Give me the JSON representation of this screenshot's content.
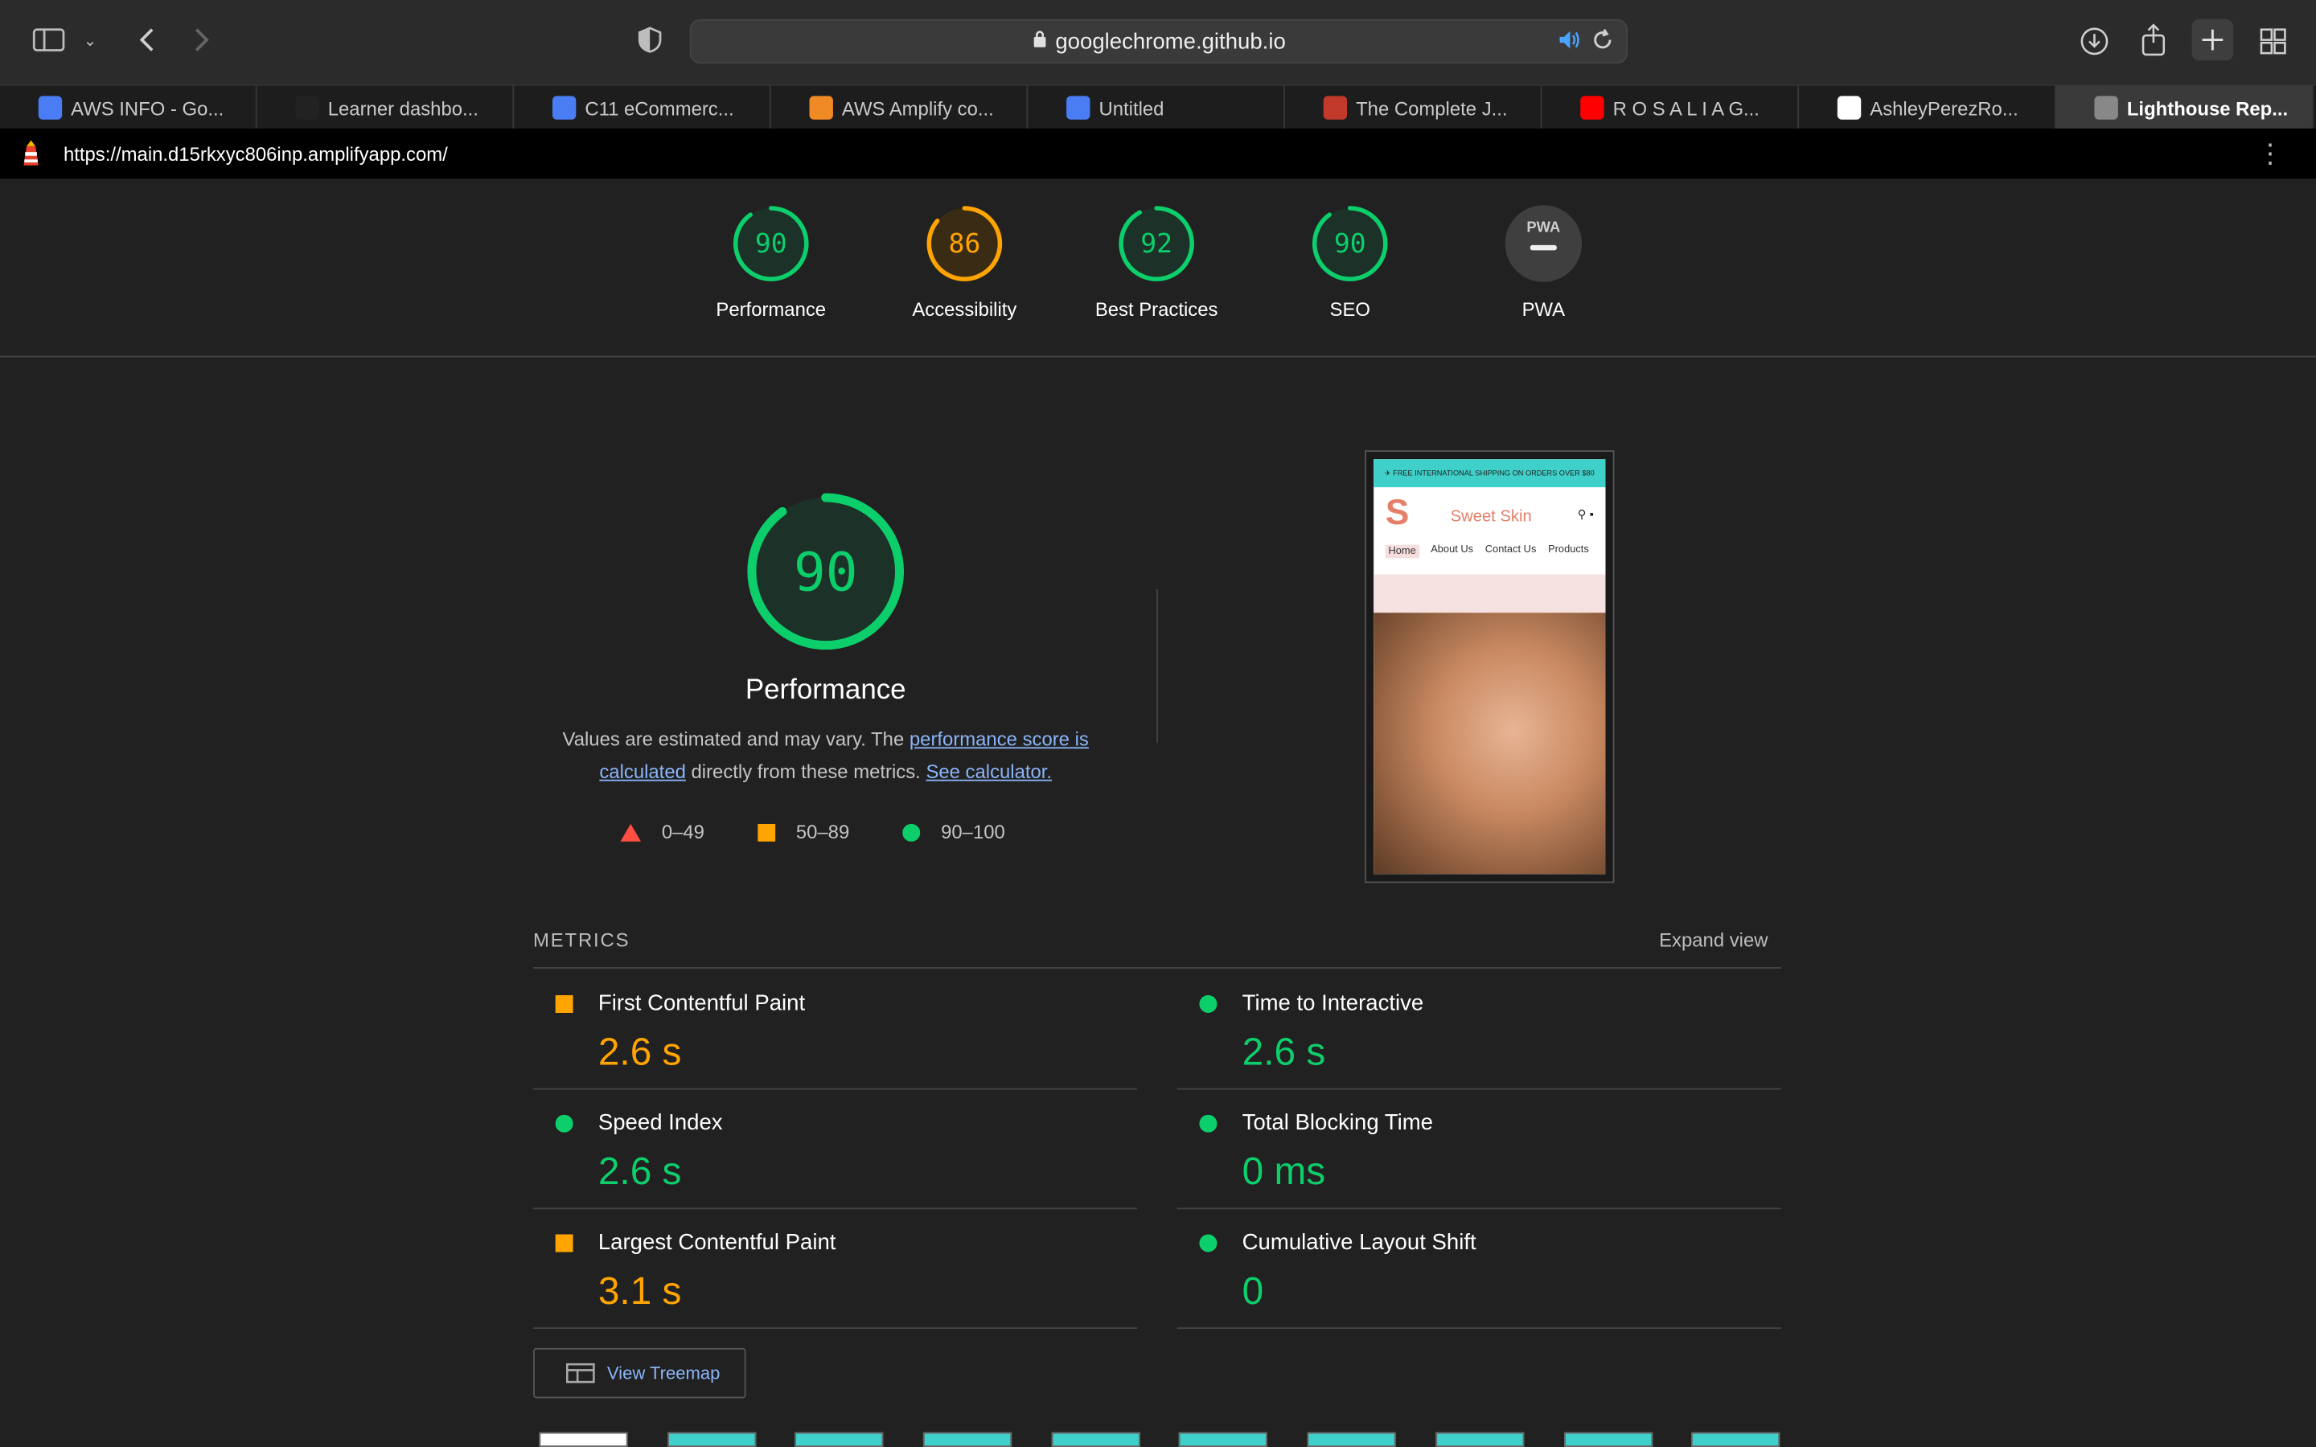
{
  "browser": {
    "address": "googlechrome.github.io"
  },
  "tabs": [
    {
      "label": "AWS INFO - Go...",
      "icon": "google-docs-icon",
      "color": "#4a7cf3"
    },
    {
      "label": "Learner dashbo...",
      "icon": "aws-icon",
      "color": "#222222"
    },
    {
      "label": "C11 eCommerc...",
      "icon": "google-docs-icon",
      "color": "#4a7cf3"
    },
    {
      "label": "AWS Amplify co...",
      "icon": "amplify-icon",
      "color": "#f08a24"
    },
    {
      "label": "Untitled",
      "icon": "google-docs-icon",
      "color": "#4a7cf3"
    },
    {
      "label": "The Complete J...",
      "icon": "course-icon",
      "color": "#c0392b"
    },
    {
      "label": "R O S A L I A G...",
      "icon": "youtube-icon",
      "color": "#ff0000"
    },
    {
      "label": "AshleyPerezRo...",
      "icon": "github-icon",
      "color": "#ffffff"
    },
    {
      "label": "Lighthouse Rep...",
      "icon": "g-icon",
      "color": "#888888"
    }
  ],
  "report": {
    "url": "https://main.d15rkxyc806inp.amplifyapp.com/"
  },
  "scores": [
    {
      "label": "Performance",
      "value": "90",
      "status": "pass"
    },
    {
      "label": "Accessibility",
      "value": "86",
      "status": "average"
    },
    {
      "label": "Best Practices",
      "value": "92",
      "status": "pass"
    },
    {
      "label": "SEO",
      "value": "90",
      "status": "pass"
    },
    {
      "label": "PWA",
      "value": "",
      "status": "na"
    }
  ],
  "performance": {
    "score": "90",
    "title": "Performance",
    "desc_pre": "Values are estimated and may vary. The ",
    "desc_link": "performance score is calculated",
    "desc_mid": " directly from these metrics. ",
    "desc_link2": "See calculator.",
    "legend": [
      "0–49",
      "50–89",
      "90–100"
    ]
  },
  "screenshot": {
    "banner": "✈ FREE INTERNATIONAL SHIPPING ON ORDERS OVER $80",
    "shop_name": "Sweet Skin",
    "nav": [
      "Home",
      "About Us",
      "Contact Us",
      "Products"
    ]
  },
  "metrics": {
    "heading": "METRICS",
    "expand": "Expand view",
    "items": [
      {
        "name": "First Contentful Paint",
        "value": "2.6 s",
        "status": "average"
      },
      {
        "name": "Time to Interactive",
        "value": "2.6 s",
        "status": "pass"
      },
      {
        "name": "Speed Index",
        "value": "2.6 s",
        "status": "pass"
      },
      {
        "name": "Total Blocking Time",
        "value": "0 ms",
        "status": "pass"
      },
      {
        "name": "Largest Contentful Paint",
        "value": "3.1 s",
        "status": "average"
      },
      {
        "name": "Cumulative Layout Shift",
        "value": "0",
        "status": "pass"
      }
    ]
  },
  "treemap": {
    "label": "View Treemap"
  },
  "colors": {
    "pass": "#0cce6b",
    "average": "#ffa400",
    "fail": "#ff4e42",
    "na": "#bdbdbd"
  }
}
